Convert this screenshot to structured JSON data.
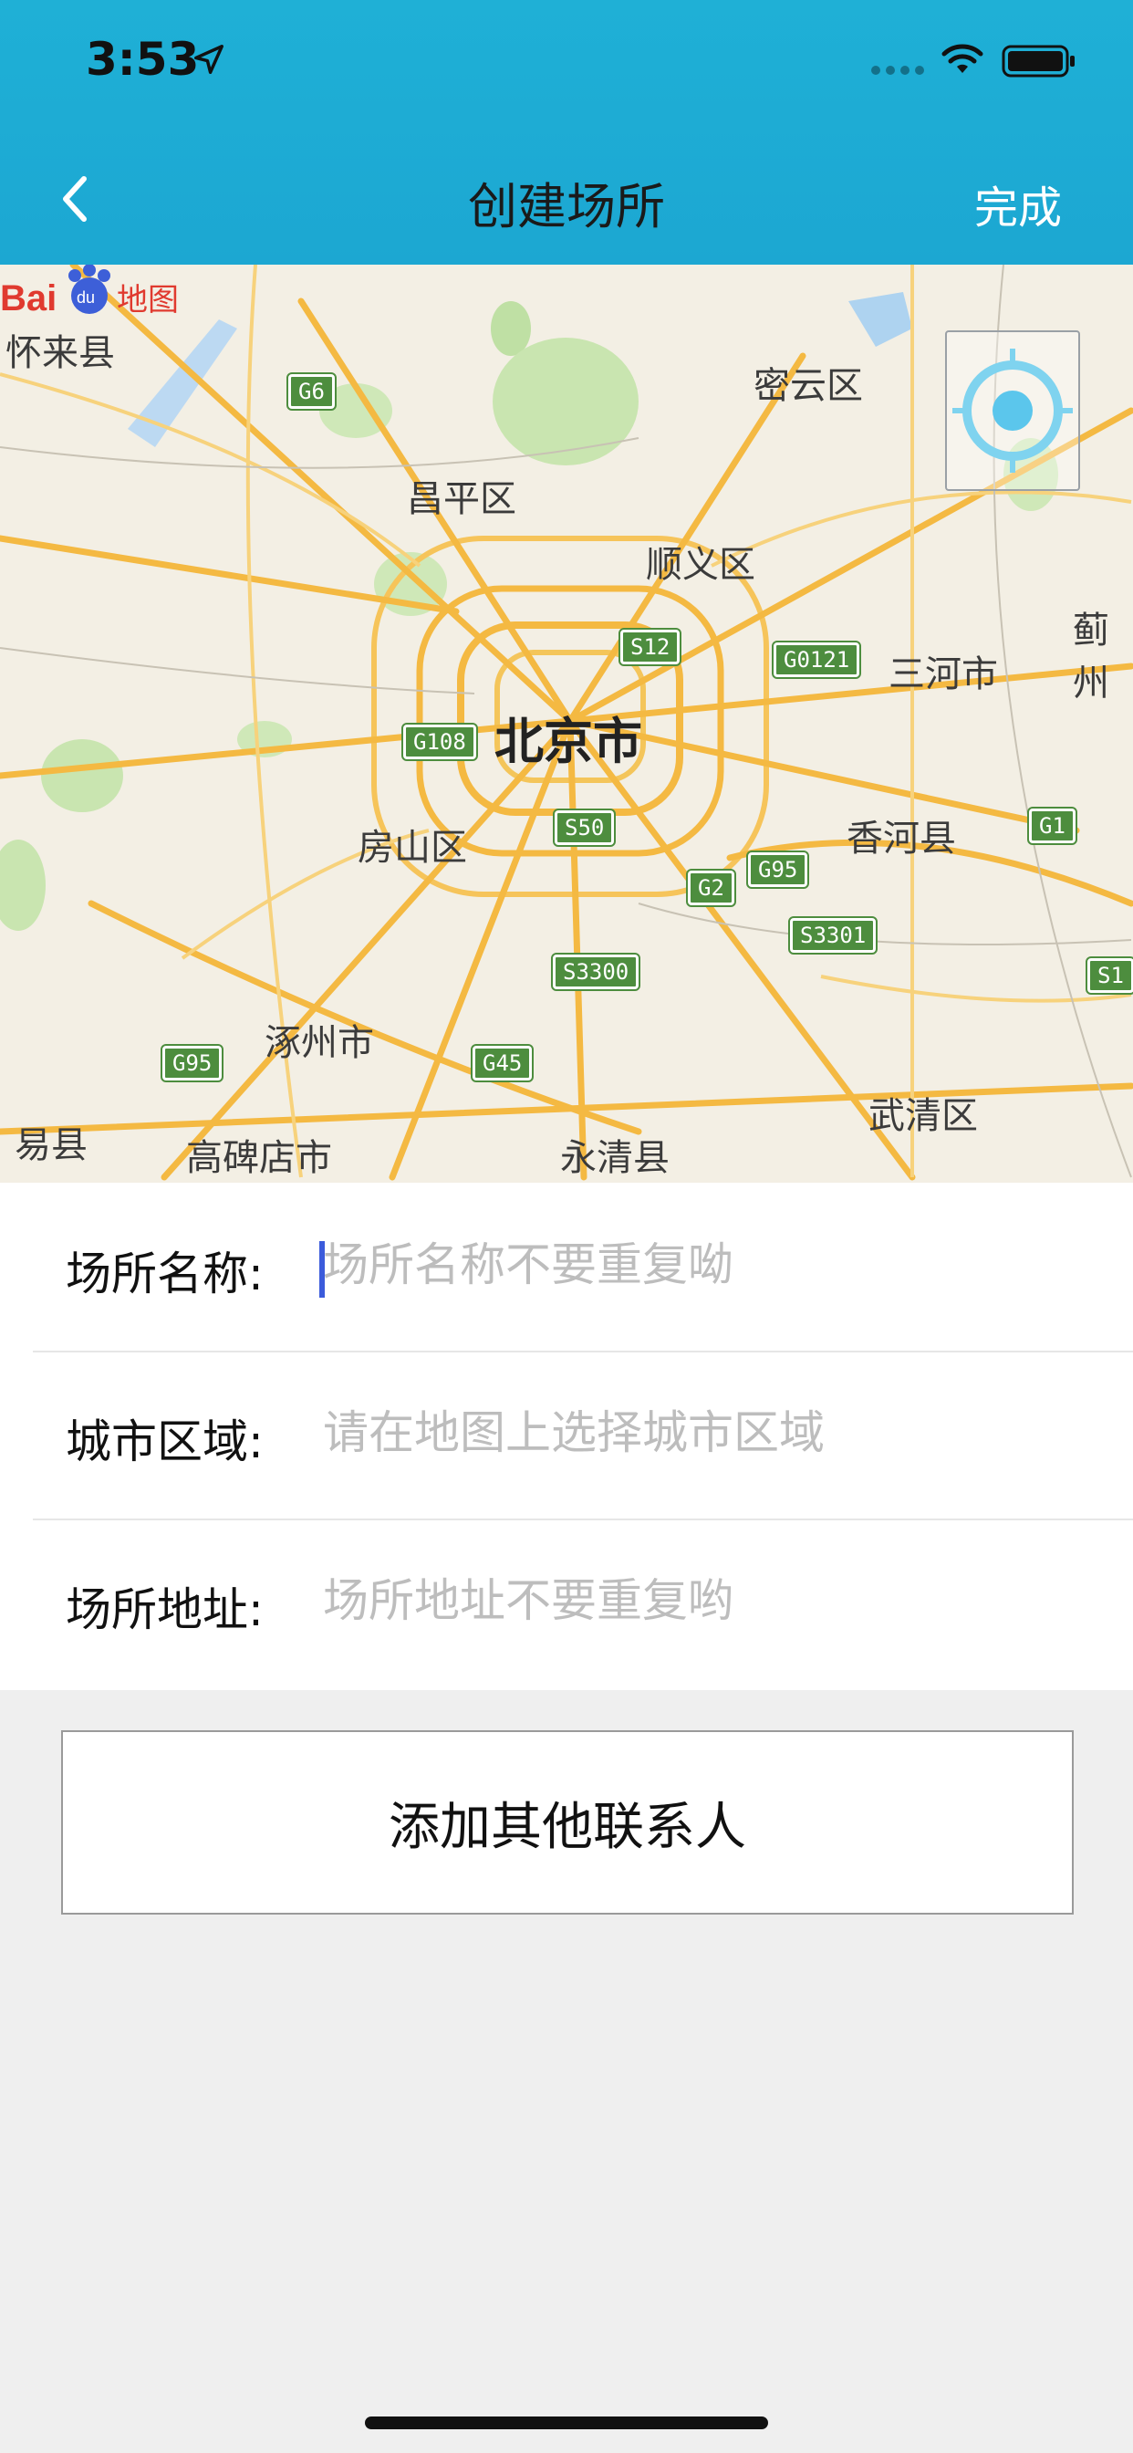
{
  "status": {
    "time": "3:53"
  },
  "nav": {
    "title": "创建场所",
    "done": "完成"
  },
  "map": {
    "labels": {
      "huailai": "怀来县",
      "miyun": "密云区",
      "changping": "昌平区",
      "shunyi": "顺义区",
      "beijing": "北京市",
      "sanhe": "三河市",
      "jixian": "蓟州",
      "fangshan": "房山区",
      "xianghe": "香河县",
      "zhuozhou": "涿州市",
      "gaobeidian": "高碑店市",
      "yongqing": "永清县",
      "wuqing": "武清区",
      "yixian": "易县"
    },
    "roads": {
      "g6": "G6",
      "s12": "S12",
      "g0121": "G0121",
      "g108": "G108",
      "s50": "S50",
      "g1": "G1",
      "g95a": "G95",
      "g2": "G2",
      "s3301": "S3301",
      "s3300": "S3300",
      "g95b": "G95",
      "g45": "G45",
      "s1": "S1"
    },
    "logo_text": "Baidu地图"
  },
  "form": {
    "name": {
      "label": "场所名称:",
      "placeholder": "场所名称不要重复呦"
    },
    "region": {
      "label": "城市区域:",
      "placeholder": "请在地图上选择城市区域"
    },
    "address": {
      "label": "场所地址:",
      "placeholder": "场所地址不要重复哟"
    }
  },
  "add_contact": "添加其他联系人"
}
